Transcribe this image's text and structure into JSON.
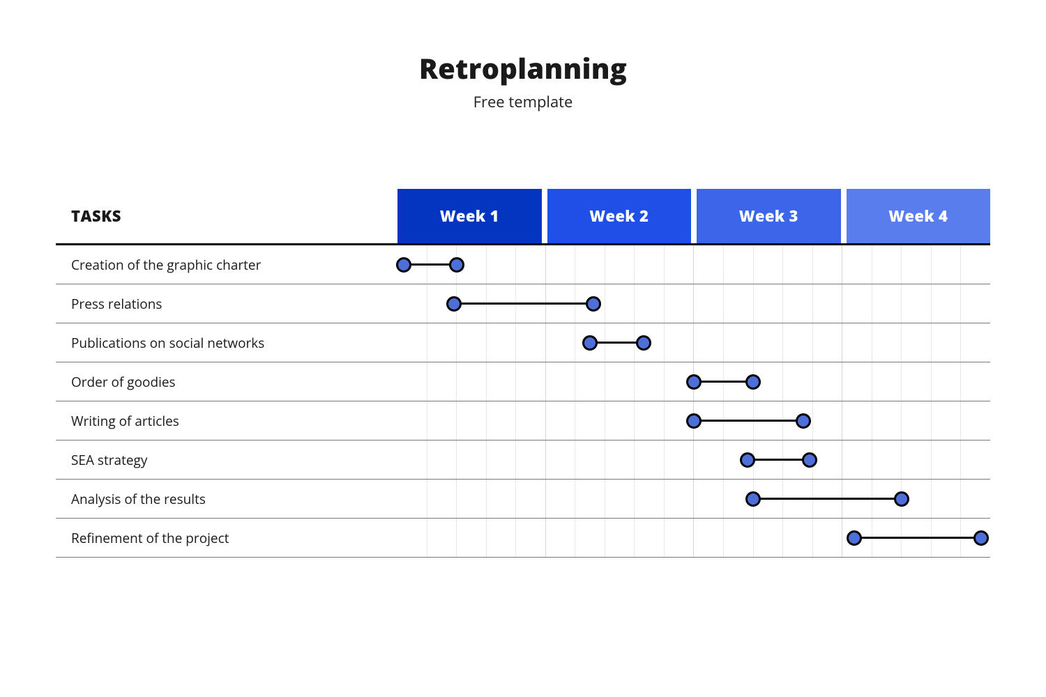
{
  "title": "Retroplanning",
  "subtitle": "Free template",
  "task_header": "TASKS",
  "week_labels": [
    "Week 1",
    "Week 2",
    "Week 3",
    "Week 4"
  ],
  "week_header_colors": [
    "#0435c0",
    "#1f4fe6",
    "#3c66ea",
    "#5a7ded"
  ],
  "dot_fill": "#4f6fd8",
  "grid_subdivisions_per_week": 5,
  "chart_data": {
    "type": "gantt",
    "title": "Retroplanning",
    "x_unit": "week (5 subdivisions each)",
    "x_range_subdivisions": [
      0,
      20
    ],
    "tasks": [
      {
        "name": "Creation of the graphic charter",
        "start": 0.2,
        "end": 2.0
      },
      {
        "name": "Press relations",
        "start": 1.9,
        "end": 6.6
      },
      {
        "name": "Publications on social networks",
        "start": 6.5,
        "end": 8.3
      },
      {
        "name": "Order of goodies",
        "start": 10.0,
        "end": 12.0
      },
      {
        "name": "Writing of articles",
        "start": 10.0,
        "end": 13.7
      },
      {
        "name": "SEA strategy",
        "start": 11.8,
        "end": 13.9
      },
      {
        "name": "Analysis of the results",
        "start": 12.0,
        "end": 17.0
      },
      {
        "name": "Refinement of the project",
        "start": 15.4,
        "end": 19.7
      }
    ]
  }
}
